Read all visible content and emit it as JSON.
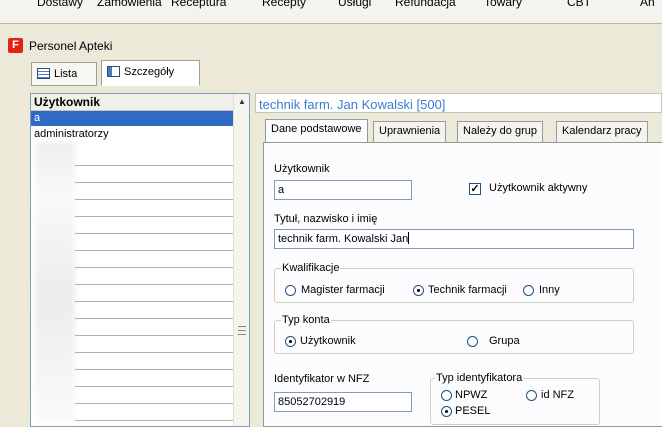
{
  "menubar": {
    "items": [
      {
        "label": "Dostawy"
      },
      {
        "label": "Zamówienia"
      },
      {
        "label": "Receptura"
      },
      {
        "label": "Recepty"
      },
      {
        "label": "Usługi"
      },
      {
        "label": "Refundacja"
      },
      {
        "label": "Towary"
      },
      {
        "label": "CBT"
      },
      {
        "label": "An"
      }
    ]
  },
  "window": {
    "title": "Personel Apteki",
    "icon": "app-icon",
    "view_tabs": [
      {
        "label": "Lista",
        "icon": "list-icon"
      },
      {
        "label": "Szczegóły",
        "icon": "details-icon"
      }
    ]
  },
  "user_list": {
    "header": "Użytkownik",
    "rows": [
      {
        "label": "a",
        "selected": true
      },
      {
        "label": "administratorzy",
        "selected": false
      }
    ]
  },
  "detail": {
    "header": "technik farm. Jan Kowalski [500]",
    "tabs": [
      {
        "label": "Dane podstawowe"
      },
      {
        "label": "Uprawnienia"
      },
      {
        "label": "Należy do grup"
      },
      {
        "label": "Kalendarz pracy"
      }
    ],
    "form": {
      "user_label": "Użytkownik",
      "user_value": "a",
      "active_label": "Użytkownik aktywny",
      "active_checked": true,
      "title_label": "Tytuł, nazwisko i imię",
      "title_value": "technik farm. Kowalski Jan",
      "qualification": {
        "legend": "Kwalifikacje",
        "options": [
          "Magister farmacji",
          "Technik farmacji",
          "Inny"
        ],
        "selected": "Technik farmacji"
      },
      "account_type": {
        "legend": "Typ konta",
        "options": [
          "Użytkownik",
          "Grupa"
        ],
        "selected": "Użytkownik"
      },
      "nfz_label": "Identyfikator w NFZ",
      "nfz_value": "85052702919",
      "id_type": {
        "legend": "Typ identyfikatora",
        "options": [
          "NPWZ",
          "id NFZ",
          "PESEL"
        ],
        "selected": "PESEL"
      }
    }
  },
  "colors": {
    "selection": "#316ac5",
    "header_link": "#3a7ed1",
    "app_icon": "#e32219"
  }
}
